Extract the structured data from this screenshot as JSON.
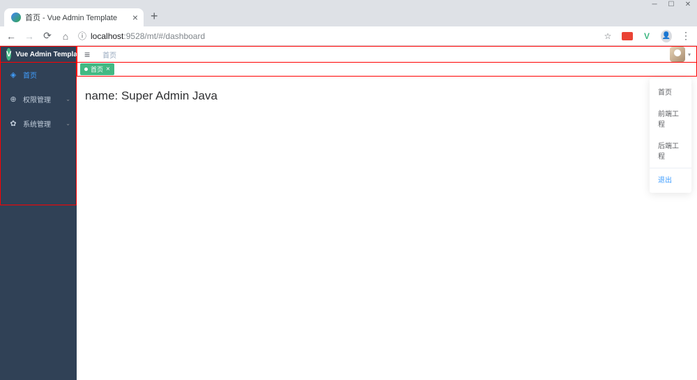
{
  "browser": {
    "tab_title": "首页 - Vue Admin Template",
    "url_host": "localhost",
    "url_port": ":9528",
    "url_path": "/mt/#/dashboard",
    "url_info_icon": "ⓘ"
  },
  "sidebar": {
    "logo_letter": "V",
    "logo_text": "Vue Admin Template",
    "items": [
      {
        "label": "首页",
        "icon": "◈",
        "active": true,
        "expandable": false
      },
      {
        "label": "权限管理",
        "icon": "⊕",
        "active": false,
        "expandable": true
      },
      {
        "label": "系统管理",
        "icon": "✿",
        "active": false,
        "expandable": true
      }
    ]
  },
  "navbar": {
    "breadcrumb": "首页"
  },
  "tags": {
    "active_label": "首页"
  },
  "content": {
    "text": "name: Super Admin Java"
  },
  "dropdown": {
    "items": [
      "首页",
      "前端工程",
      "后端工程"
    ],
    "logout": "退出"
  }
}
